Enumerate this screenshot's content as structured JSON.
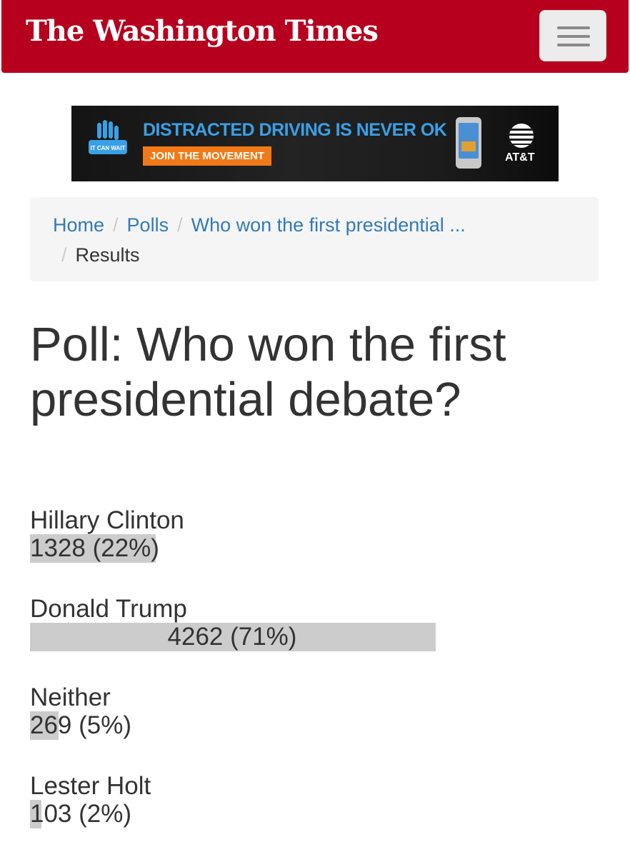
{
  "header": {
    "brand": "The Washington Times"
  },
  "ad": {
    "headline": "DISTRACTED DRIVING IS NEVER OK",
    "cta": "JOIN THE MOVEMENT",
    "sponsor": "AT&T",
    "badge": "IT CAN WAIT",
    "colors": {
      "headline": "#3aa0e6",
      "cta": "#f07a17"
    }
  },
  "breadcrumb": {
    "items": [
      {
        "label": "Home"
      },
      {
        "label": "Polls"
      },
      {
        "label": "Who won the first presidential ..."
      }
    ],
    "active": "Results"
  },
  "poll": {
    "title": "Poll: Who won the first presidential debate?",
    "results": [
      {
        "label": "Hillary Clinton",
        "count_text": "1328 (22%)",
        "votes": 1328,
        "percent": 22
      },
      {
        "label": "Donald Trump",
        "count_text": "4262 (71%)",
        "votes": 4262,
        "percent": 71
      },
      {
        "label": "Neither",
        "count_text": "269 (5%)",
        "votes": 269,
        "percent": 5
      },
      {
        "label": "Lester Holt",
        "count_text": "103 (2%)",
        "votes": 103,
        "percent": 2
      }
    ]
  },
  "colors": {
    "header_bg": "#b7001e",
    "link": "#337ab7",
    "bar": "#cccccc"
  }
}
